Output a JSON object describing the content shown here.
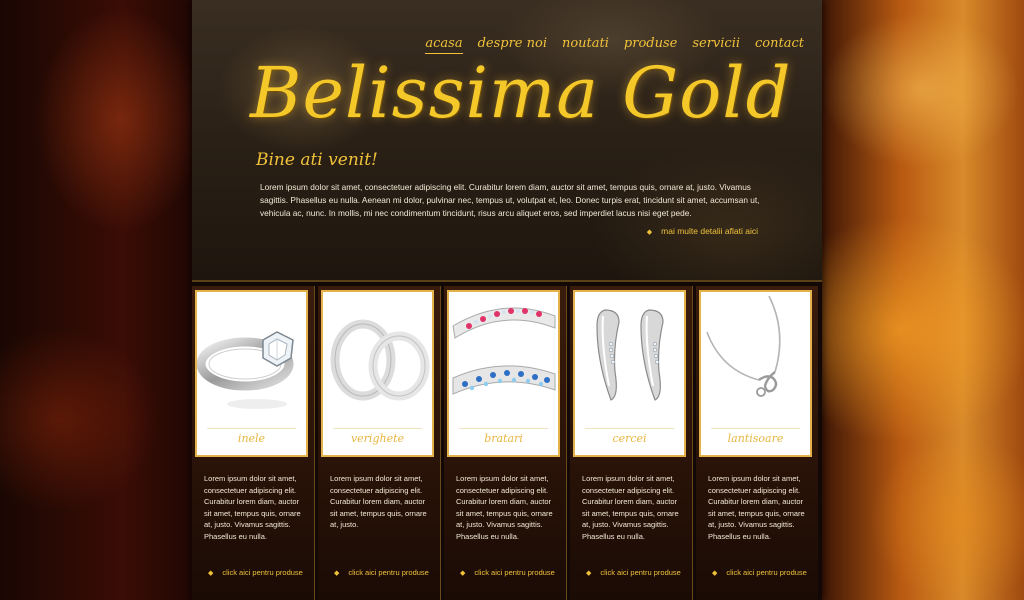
{
  "brand": {
    "title": "Belissima Gold"
  },
  "nav": {
    "items": [
      "acasa",
      "despre noi",
      "noutati",
      "produse",
      "servicii",
      "contact"
    ],
    "active": "acasa"
  },
  "hero": {
    "welcome": "Bine ati venit!",
    "intro": "Lorem ipsum dolor sit amet, consectetuer adipiscing elit. Curabitur lorem diam, auctor sit amet, tempus quis, ornare at, justo. Vivamus sagittis. Phasellus eu nulla. Aenean mi dolor, pulvinar nec, tempus ut, volutpat et, leo. Donec turpis erat, tincidunt sit amet, accumsan ut, vehicula ac, nunc. In mollis, mi nec condimentum tincidunt, risus arcu aliquet eros, sed imperdiet lacus nisi eget pede.",
    "more_link": "mai multe detalii aflati aici"
  },
  "products": [
    {
      "name": "inele",
      "icon": "ring-icon",
      "description": "Lorem ipsum dolor sit amet, consectetuer adipiscing elit. Curabitur lorem diam, auctor sit amet, tempus quis, ornare at, justo. Vivamus sagittis. Phasellus eu nulla.",
      "link": "click aici pentru produse"
    },
    {
      "name": "verighete",
      "icon": "wedding-bands-icon",
      "description": "Lorem ipsum dolor sit amet, consectetuer adipiscing elit. Curabitur lorem diam, auctor sit amet, tempus quis, ornare at, justo.",
      "link": "click aici pentru produse"
    },
    {
      "name": "bratari",
      "icon": "bracelet-icon",
      "description": "Lorem ipsum dolor sit amet, consectetuer adipiscing elit. Curabitur lorem diam, auctor sit amet, tempus quis, ornare at, justo. Vivamus sagittis. Phasellus eu nulla.",
      "link": "click aici pentru produse"
    },
    {
      "name": "cercei",
      "icon": "earrings-icon",
      "description": "Lorem ipsum dolor sit amet, consectetuer adipiscing elit. Curabitur lorem diam, auctor sit amet, tempus quis, ornare at, justo. Vivamus sagittis. Phasellus eu nulla.",
      "link": "click aici pentru produse"
    },
    {
      "name": "lantisoare",
      "icon": "necklace-icon",
      "description": "Lorem ipsum dolor sit amet, consectetuer adipiscing elit. Curabitur lorem diam, auctor sit amet, tempus quis, ornare at, justo. Vivamus sagittis. Phasellus eu nulla.",
      "link": "click aici pentru produse"
    }
  ],
  "colors": {
    "gold": "#f0c23a",
    "card_border": "#e4b24a",
    "text": "#f3ead8"
  }
}
